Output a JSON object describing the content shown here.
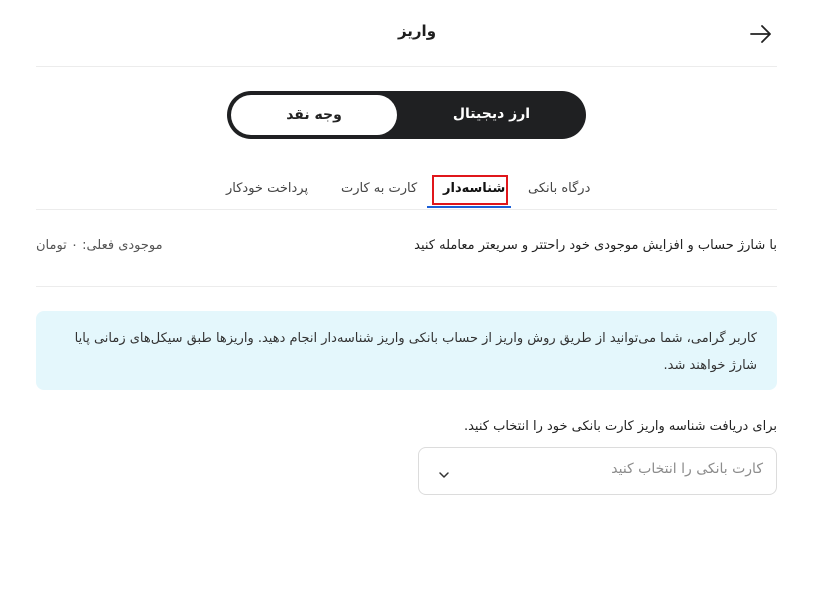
{
  "header": {
    "title": "واریز",
    "back_icon": "arrow-right-icon"
  },
  "currency_toggle": {
    "active_label": "ارز دیجیتال",
    "inactive_label": "وجه نقد"
  },
  "tabs": [
    {
      "label": "درگاه بانکی",
      "active": false
    },
    {
      "label": "شناسه‌دار",
      "active": true
    },
    {
      "label": "کارت به کارت",
      "active": false
    },
    {
      "label": "پرداخت خودکار",
      "active": false
    }
  ],
  "promo_text": "با شارژ حساب و افزایش موجودی خود راحتتر و سریعتر معامله کنید",
  "balance": {
    "label": "موجودی فعلی:",
    "value": "۰ تومان"
  },
  "info_message": "کاربر گرامی، شما می‌توانید از طریق روش واریز از حساب بانکی واریز شناسه‌دار انجام دهید. واریزها طبق سیکل‌های زمانی پایا شارژ خواهند شد.",
  "card_select": {
    "prompt": "برای دریافت شناسه واریز کارت بانکی خود را انتخاب کنید.",
    "placeholder": "کارت بانکی را انتخاب کنید",
    "chevron_icon": "chevron-down-icon"
  },
  "colors": {
    "accent_underline": "#1c5fd6",
    "highlight_box": "#e0161b",
    "info_bg": "#e4f7fc",
    "toggle_bg": "#1f2022"
  }
}
